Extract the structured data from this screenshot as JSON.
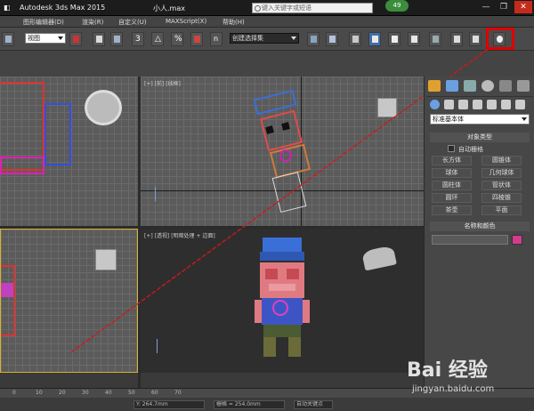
{
  "titlebar": {
    "app": "Autodesk 3ds Max  2015",
    "file": "小人.max",
    "search_placeholder": "键入关键字或短语",
    "badge": "49",
    "minimize": "—",
    "restore": "❐",
    "close": "✕"
  },
  "menu": {
    "items": [
      "图形编辑器(D)",
      "渲染(R)",
      "自定义(U)",
      "MAXScript(X)",
      "帮助(H)"
    ]
  },
  "toolbar": {
    "view_select": "视图",
    "selection_set": "创建选择集",
    "snap_3": "3",
    "snap_angle": "△",
    "snap_pct": "%",
    "snap_n": "n"
  },
  "viewports": {
    "front_label": "[+] [前] [线框]",
    "persp_label": "[+] [透视] [明暗处理 + 边面]"
  },
  "command_panel": {
    "dropdown": "标准基本体",
    "object_type_header": "对象类型",
    "autogrid": "自动栅格",
    "buttons": [
      "长方体",
      "圆锥体",
      "球体",
      "几何球体",
      "圆柱体",
      "管状体",
      "圆环",
      "四棱锥",
      "茶壶",
      "平面"
    ],
    "name_color_header": "名称和颜色",
    "name_value": "",
    "swatch_color": "#d23c8c"
  },
  "status": {
    "ruler_ticks": [
      "0",
      "10",
      "20",
      "30",
      "40",
      "50",
      "60",
      "70"
    ],
    "field_y": "Y: 264.7mm",
    "field_grid": "栅格 = 254.0mm",
    "field_auto": "自动关键点"
  },
  "colors": {
    "highlight_box": "#e00000",
    "pointer_line": "#d01818",
    "char_hat": "#3a6fd8",
    "char_body": "#3d55c4",
    "char_head": "#e07a82",
    "char_pants": "#4b5b32"
  },
  "watermark": {
    "brand": "Bai 经验",
    "site": "jingyan.baidu.com"
  }
}
